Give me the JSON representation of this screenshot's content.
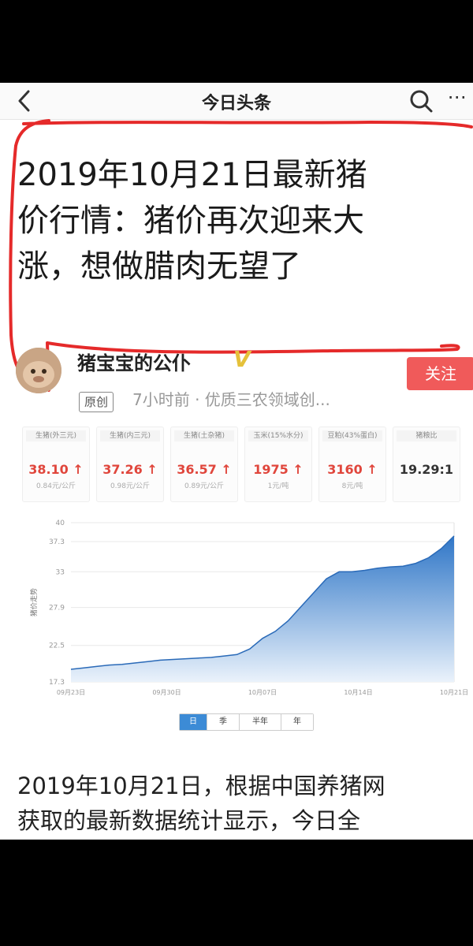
{
  "app": {
    "title": "今日头条"
  },
  "article": {
    "headline_lines": [
      "2019年10月21日最新猪",
      "价行情：猪价再次迎来大",
      "涨，想做腊肉无望了"
    ],
    "author": "猪宝宝的公仆",
    "verified_badge": "V",
    "tag": "原创",
    "meta": "7小时前 · 优质三农领域创...",
    "follow_label": "关注",
    "body_lines": [
      "2019年10月21日，根据中国养猪网",
      "获取的最新数据统计显示，今日全"
    ]
  },
  "stats": [
    {
      "label": "生猪(外三元)",
      "value": "38.10",
      "unit": "0.84元/公斤",
      "trend": "up"
    },
    {
      "label": "生猪(内三元)",
      "value": "37.26",
      "unit": "0.98元/公斤",
      "trend": "up"
    },
    {
      "label": "生猪(土杂猪)",
      "value": "36.57",
      "unit": "0.89元/公斤",
      "trend": "up"
    },
    {
      "label": "玉米(15%水分)",
      "value": "1975",
      "unit": "1元/吨",
      "trend": "up"
    },
    {
      "label": "豆粕(43%蛋白)",
      "value": "3160",
      "unit": "8元/吨",
      "trend": "up"
    },
    {
      "label": "猪粮比",
      "value": "19.29:1",
      "unit": "",
      "trend": ""
    }
  ],
  "chart_data": {
    "type": "area",
    "ylabel": "猪价走势",
    "ylim": [
      17.3,
      40
    ],
    "yticks": [
      17.3,
      22.5,
      27.9,
      33,
      37.3,
      40
    ],
    "x_ticks": [
      "09月23日",
      "09月30日",
      "10月07日",
      "10月14日",
      "10月21日"
    ],
    "series": [
      {
        "values": [
          19.1,
          19.3,
          19.5,
          19.7,
          19.8,
          20.0,
          20.2,
          20.4,
          20.5,
          20.6,
          20.7,
          20.8,
          21.0,
          21.2,
          22.0,
          23.5,
          24.5,
          26.0,
          28.0,
          30.0,
          32.0,
          33.0,
          33.0,
          33.2,
          33.5,
          33.7,
          33.8,
          34.2,
          35.0,
          36.3,
          38.1
        ]
      }
    ],
    "colors": {
      "fill_top": "#2f76c7",
      "fill_bottom": "#eaf2fb",
      "line": "#2a6ab8"
    }
  },
  "range_buttons": [
    "日",
    "季",
    "半年",
    "年"
  ],
  "icons": {
    "back": "chevron-left-icon",
    "search": "search-icon",
    "more": "more-icon"
  },
  "colors": {
    "accent_red": "#e0463c",
    "annotation_red": "#e52a2a"
  }
}
